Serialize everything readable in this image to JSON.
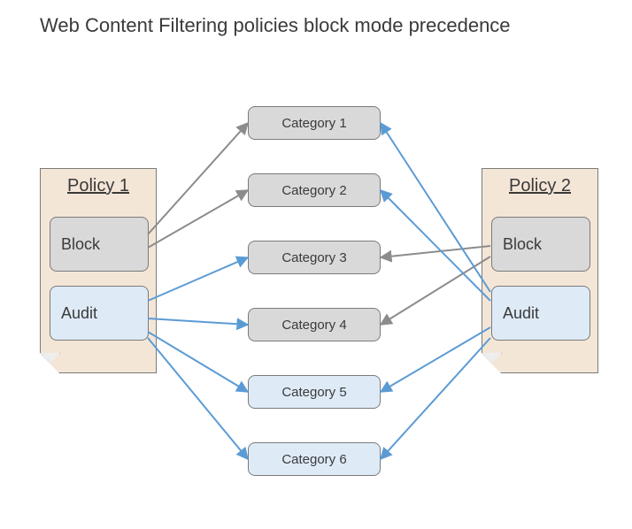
{
  "title": "Web Content Filtering policies block mode precedence",
  "policy1": {
    "title": "Policy 1",
    "block": "Block",
    "audit": "Audit"
  },
  "policy2": {
    "title": "Policy 2",
    "block": "Block",
    "audit": "Audit"
  },
  "categories": {
    "c1": "Category  1",
    "c2": "Category  2",
    "c3": "Category  3",
    "c4": "Category  4",
    "c5": "Category  5",
    "c6": "Category  6"
  },
  "colors": {
    "gray_arrow": "#8c8c8c",
    "blue_arrow": "#5b9bd5"
  },
  "edges_gray": [
    {
      "from": "p1.block",
      "to": "c1"
    },
    {
      "from": "p1.block",
      "to": "c2"
    },
    {
      "from": "p2.block",
      "to": "c3"
    },
    {
      "from": "p2.block",
      "to": "c4"
    }
  ],
  "edges_blue": [
    {
      "from": "p1.audit",
      "to": "c3"
    },
    {
      "from": "p1.audit",
      "to": "c4"
    },
    {
      "from": "p1.audit",
      "to": "c5"
    },
    {
      "from": "p1.audit",
      "to": "c6"
    },
    {
      "from": "p2.audit",
      "to": "c1"
    },
    {
      "from": "p2.audit",
      "to": "c2"
    },
    {
      "from": "p2.audit",
      "to": "c5"
    },
    {
      "from": "p2.audit",
      "to": "c6"
    }
  ]
}
